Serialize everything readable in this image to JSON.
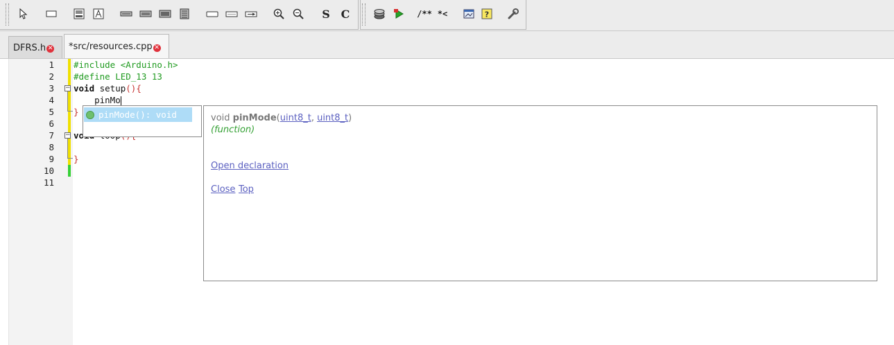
{
  "toolbar": {
    "group1_icons": [
      "select-arrow-icon",
      "rectangle-icon",
      "image-icon",
      "image-text-icon",
      "bar-narrow-icon",
      "bar-medium-icon",
      "bar-wide-icon",
      "bar-tall-icon",
      "button-shape-icon",
      "button-shape-2-icon",
      "button-shape-3-icon",
      "zoom-in-icon",
      "zoom-out-icon",
      "s-icon",
      "c-icon"
    ],
    "s_glyph": "S",
    "c_glyph": "C",
    "group2_icons": [
      "stack-icon",
      "run-icon",
      "doc-comment-icon",
      "uncomment-icon",
      "image-window-icon",
      "help-icon",
      "wrench-icon"
    ],
    "doc_comment_label": "/**",
    "uncomment_label": "*<"
  },
  "tabs": [
    {
      "label": "DFRS.h",
      "active": false
    },
    {
      "label": "*src/resources.cpp",
      "active": true
    }
  ],
  "editor": {
    "line_numbers": [
      "1",
      "2",
      "3",
      "4",
      "5",
      "6",
      "7",
      "8",
      "9",
      "10",
      "11"
    ],
    "lines": {
      "l1": "#include <Arduino.h>",
      "l2": "#define LED_13 13",
      "l3_kw": "void",
      "l3_rest": " setup",
      "l3_br": "(){",
      "l4": "    pinMo",
      "l5_br": "}",
      "l7_kw": "void",
      "l7_rest": " loop",
      "l7_br": "(){",
      "l9_br": "}"
    },
    "colors": {
      "preprocessor": "#1f9a1f",
      "brace": "#c5302e",
      "modified_marker": "#f0e000",
      "saved_marker": "#35d035"
    }
  },
  "autocomplete": {
    "item": "pinMode(): void"
  },
  "doc_popup": {
    "return_type": "void",
    "name": "pinMode",
    "open_paren": "(",
    "param1": "uint8_t",
    "sep": ", ",
    "param2": "uint8_t",
    "close_paren": ")",
    "kind": "(function)",
    "open_declaration": "Open declaration",
    "close": "Close",
    "top": "Top"
  }
}
